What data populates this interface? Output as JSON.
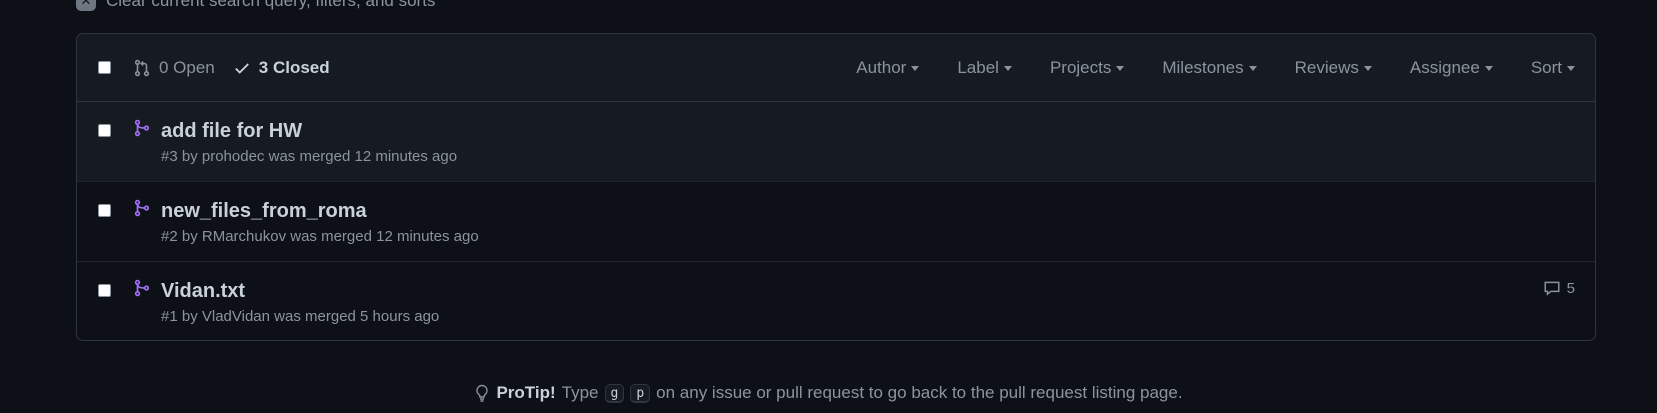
{
  "clear_filters": {
    "label": "Clear current search query, filters, and sorts"
  },
  "header": {
    "open_label": "0 Open",
    "closed_label": "3 Closed",
    "filters": [
      "Author",
      "Label",
      "Projects",
      "Milestones",
      "Reviews",
      "Assignee",
      "Sort"
    ]
  },
  "pull_requests": [
    {
      "title": "add file for HW",
      "number": "#3",
      "author": "prohodec",
      "status_text": "was merged 12 minutes ago",
      "comments": ""
    },
    {
      "title": "new_files_from_roma",
      "number": "#2",
      "author": "RMarchukov",
      "status_text": "was merged 12 minutes ago",
      "comments": ""
    },
    {
      "title": "Vidan.txt",
      "number": "#1",
      "author": "VladVidan",
      "status_text": "was merged 5 hours ago",
      "comments": "5"
    }
  ],
  "protip": {
    "label": "ProTip!",
    "before": "Type",
    "key1": "g",
    "key2": "p",
    "after": "on any issue or pull request to go back to the pull request listing page."
  },
  "colors": {
    "merged": "#a371f7",
    "background": "#0d1117",
    "header_bg": "#161b22",
    "border": "#30363d"
  }
}
